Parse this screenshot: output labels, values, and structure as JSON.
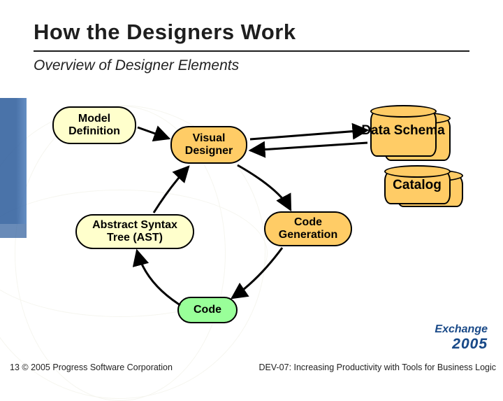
{
  "title": "How the Designers Work",
  "subtitle": "Overview of Designer Elements",
  "nodes": {
    "model_definition": "Model\nDefinition",
    "visual_designer": "Visual\nDesigner",
    "data_schema": "Data\nSchema",
    "catalog": "Catalog",
    "abstract_syntax_tree": "Abstract Syntax\nTree (AST)",
    "code_generation": "Code\nGeneration",
    "code": "Code"
  },
  "footer": {
    "slide_number": "13",
    "copyright": "© 2005 Progress Software Corporation",
    "session": "DEV-07: Increasing Productivity with Tools for Business Logic"
  },
  "brand": {
    "name": "Exchange",
    "year": "2005"
  },
  "colors": {
    "yellow": "#ffffcc",
    "orange": "#ffcc66",
    "green": "#99ff99",
    "brand_blue": "#1a4a88"
  }
}
